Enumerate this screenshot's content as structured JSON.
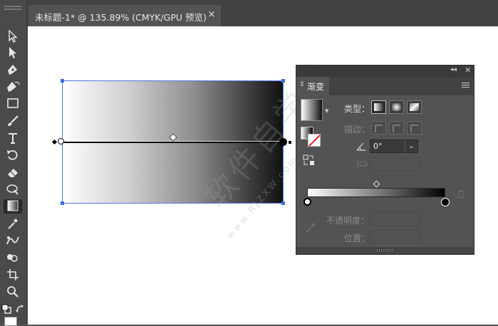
{
  "document_tab": {
    "title": "未标题-1* @ 135.89% (CMYK/GPU 预览)",
    "close": "×"
  },
  "tools": [
    "selection-tool",
    "direct-selection-tool",
    "pen-tool",
    "curvature-tool",
    "rectangle-tool",
    "paintbrush-tool",
    "shaper-tool",
    "type-tool",
    "rotate-tool",
    "eraser-tool",
    "width-tool",
    "gradient-tool",
    "eyedropper-tool",
    "blend-tool",
    "shape-builder-tool",
    "artboard-tool",
    "zoom-tool",
    "fill-stroke-swatches",
    "swap-fill-stroke"
  ],
  "active_tool": "gradient-tool",
  "watermark": {
    "text": "软件自学网",
    "url": "www.RJZXW.com"
  },
  "gradient_panel": {
    "tab_label": "渐变",
    "type_label": "类型：",
    "stroke_label": "描边：",
    "angle_value": "0°",
    "opacity_label": "不透明度：",
    "location_label": "位置：",
    "gradient_type_selected": "linear",
    "gradient_stops": [
      {
        "color": "#ffffff",
        "location_percent": 0
      },
      {
        "color": "#000000",
        "location_percent": 100
      }
    ],
    "midpoint_percent": 50
  },
  "colors": {
    "selection": "#4a78e6",
    "ui_bg": "#535353",
    "canvas": "#ffffff"
  }
}
